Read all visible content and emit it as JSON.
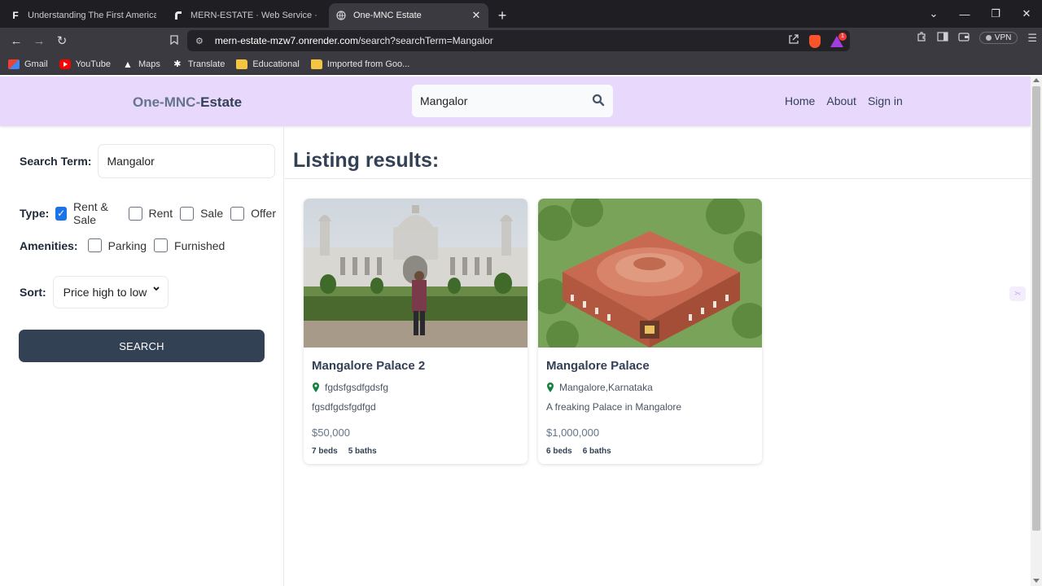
{
  "browser": {
    "tabs": [
      {
        "title": "Understanding The First American Fi",
        "favicon": "F",
        "active": false
      },
      {
        "title": "MERN-ESTATE · Web Service · Rend",
        "favicon": "render-icon",
        "active": false
      },
      {
        "title": "One-MNC Estate",
        "favicon": "globe-icon",
        "active": true
      }
    ],
    "url_host": "mern-estate-mzw7.onrender.com",
    "url_path": "/search?searchTerm=Mangalor",
    "vpn_label": "VPN",
    "rewards_badge": "1",
    "bookmarks": [
      "Gmail",
      "YouTube",
      "Maps",
      "Translate",
      "Educational",
      "Imported from Goo..."
    ]
  },
  "header": {
    "logo_part1": "One-MNC-",
    "logo_part2": "Estate",
    "search_value": "Mangalor",
    "nav": [
      "Home",
      "About",
      "Sign in"
    ]
  },
  "filters": {
    "search_term_label": "Search Term:",
    "search_term_value": "Mangalor",
    "type_label": "Type:",
    "types": [
      {
        "label": "Rent & Sale",
        "checked": true
      },
      {
        "label": "Rent",
        "checked": false
      },
      {
        "label": "Sale",
        "checked": false
      },
      {
        "label": "Offer",
        "checked": false
      }
    ],
    "amenities_label": "Amenities:",
    "amenities": [
      {
        "label": "Parking",
        "checked": false
      },
      {
        "label": "Furnished",
        "checked": false
      }
    ],
    "sort_label": "Sort:",
    "sort_value": "Price high to low",
    "search_button": "SEARCH"
  },
  "results": {
    "title": "Listing results:",
    "listings": [
      {
        "name": "Mangalore Palace 2",
        "address": "fgdsfgsdfgdsfg",
        "description": "fgsdfgdsfgdfgd",
        "price": "$50,000",
        "beds": "7 beds",
        "baths": "5 baths"
      },
      {
        "name": "Mangalore Palace",
        "address": "Mangalore,Karnataka",
        "description": "A freaking Palace in Mangalore",
        "price": "$1,000,000",
        "beds": "6 beds",
        "baths": "6 baths"
      }
    ]
  },
  "colors": {
    "header_bg": "#e8d9fc",
    "primary_dark": "#334155",
    "checkbox_accent": "#1a73e8",
    "pin_green": "#15803d"
  }
}
